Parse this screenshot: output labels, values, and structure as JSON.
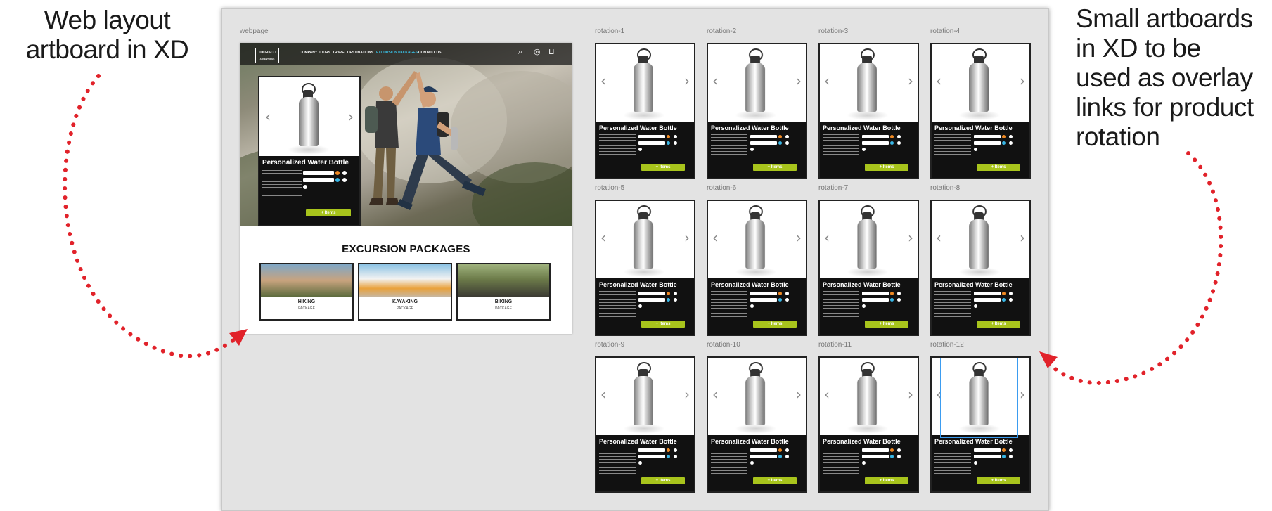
{
  "callouts": {
    "left_lines": [
      "Web layout",
      "artboard in XD"
    ],
    "right_lines": [
      "Small artboards",
      "in XD to be",
      "used as overlay",
      "links for product",
      "rotation"
    ],
    "arrow_color": "#e1222a"
  },
  "canvas": {
    "background": "#e3e3e3",
    "webpage_label": "webpage"
  },
  "webpage": {
    "nav": {
      "logo_lines": [
        "TOUR&CO",
        "ADVENTURES"
      ],
      "links": [
        "COMPANY TOURS",
        "TRAVEL DESTINATIONS",
        "EXCURSION PACKAGES",
        "CONTACT US"
      ],
      "active_link_index": 2,
      "icons": [
        "search-icon",
        "globe-icon",
        "cart-icon"
      ]
    },
    "section_title": "EXCURSION PACKAGES",
    "packages": [
      {
        "label": "HIKING",
        "sub": "PACKAGE"
      },
      {
        "label": "KAYAKING",
        "sub": "PACKAGE"
      },
      {
        "label": "BIKING",
        "sub": "PACKAGE"
      }
    ]
  },
  "product_card": {
    "title": "Personalized Water Bottle",
    "button_label": "+ Items",
    "prev_icon": "chevron-left-icon",
    "next_icon": "chevron-right-icon",
    "accent": "#a8c41c",
    "swatch_colors": [
      "#f08a24",
      "#39b7e6",
      "#ffffff"
    ]
  },
  "rotation_boards": [
    {
      "label": "rotation-1"
    },
    {
      "label": "rotation-2"
    },
    {
      "label": "rotation-3"
    },
    {
      "label": "rotation-4"
    },
    {
      "label": "rotation-5"
    },
    {
      "label": "rotation-6"
    },
    {
      "label": "rotation-7"
    },
    {
      "label": "rotation-8"
    },
    {
      "label": "rotation-9"
    },
    {
      "label": "rotation-10"
    },
    {
      "label": "rotation-11"
    },
    {
      "label": "rotation-12",
      "selected": true
    }
  ]
}
